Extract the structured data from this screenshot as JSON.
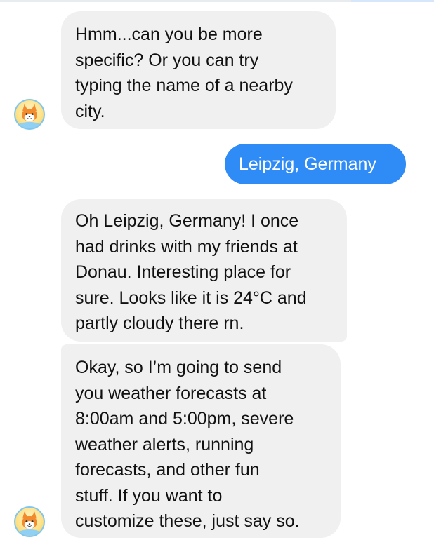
{
  "messages": [
    {
      "from": "bot",
      "text": "Hmm...can you be more\nspecific? Or you can try\ntyping the name of a nearby\ncity."
    },
    {
      "from": "user",
      "text": "Leipzig, Germany"
    },
    {
      "from": "bot",
      "text": "Oh Leipzig, Germany! I once\nhad drinks with my friends at\nDonau. Interesting place for\nsure. Looks like it is 24°C and\npartly cloudy there rn."
    },
    {
      "from": "bot",
      "text": "Okay, so I’m going to send\nyou weather forecasts at\n8:00am and 5:00pm, severe\nweather alerts, running\nforecasts, and other fun\nstuff. If you want to\ncustomize these, just say so."
    }
  ],
  "bot_avatar_icon": "fox-weather-bot-icon",
  "colors": {
    "user_bubble": "#2f8bf6",
    "bot_bubble": "#f1f0f0",
    "bot_text": "#111111",
    "user_text": "#ffffff"
  }
}
